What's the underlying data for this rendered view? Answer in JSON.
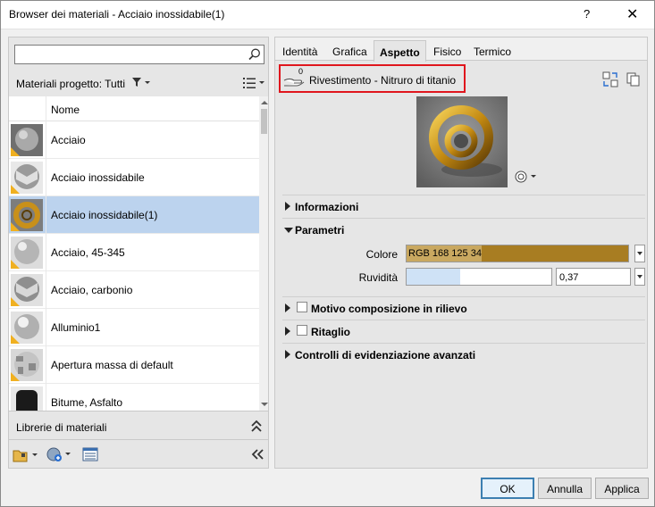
{
  "window": {
    "title": "Browser dei materiali - Acciaio inossidabile(1)",
    "help": "?",
    "close": "✕"
  },
  "left": {
    "search": {
      "value": "",
      "placeholder": ""
    },
    "project_label": "Materiali progetto: Tutti",
    "column_name": "Nome",
    "materials": [
      {
        "label": "Acciaio"
      },
      {
        "label": "Acciaio inossidabile"
      },
      {
        "label": "Acciaio inossidabile(1)",
        "selected": true
      },
      {
        "label": "Acciaio, 45-345"
      },
      {
        "label": "Acciaio, carbonio"
      },
      {
        "label": "Alluminio1"
      },
      {
        "label": "Apertura massa di default"
      },
      {
        "label": "Bitume, Asfalto"
      }
    ],
    "libraries_label": "Librerie di materiali"
  },
  "right": {
    "tabs": [
      {
        "label": "Identità"
      },
      {
        "label": "Grafica"
      },
      {
        "label": "Aspetto",
        "active": true
      },
      {
        "label": "Fisico"
      },
      {
        "label": "Termico"
      }
    ],
    "asset_count": "0",
    "asset_name": "Rivestimento - Nitruro di titanio",
    "sections": {
      "informazioni": "Informazioni",
      "parametri": "Parametri",
      "motivo": "Motivo composizione in rilievo",
      "ritaglio": "Ritaglio",
      "controlli": "Controlli di evidenziazione avanzati"
    },
    "params": {
      "colore_label": "Colore",
      "colore_value": "RGB 168 125 34",
      "rugosita_label": "Ruvidità",
      "rugosita_value": "0,37"
    }
  },
  "buttons": {
    "ok": "OK",
    "annulla": "Annulla",
    "applica": "Applica"
  },
  "colors": {
    "accent_red": "#e0161d",
    "selection": "#bcd3ee",
    "material_color": "#a87d22"
  }
}
